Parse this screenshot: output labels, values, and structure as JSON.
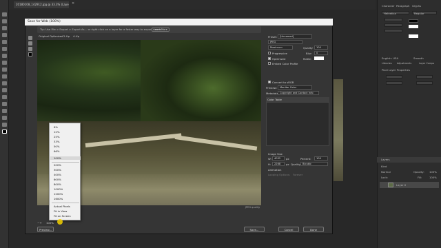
{
  "document_tab": {
    "title": "20180108_142912.jpg @ 33.3% (Layer 0, RGB/8)",
    "close": "×"
  },
  "dialog": {
    "title": "Save for Web (100%)",
    "info_bar": "Tip: Use File > Export > Export As... or right click on a layer for a faster way to export assets",
    "learn_more": "Learn More",
    "view_tabs": [
      "Original",
      "Optimized",
      "2-Up",
      "4-Up"
    ],
    "photo_caption": "JPEG quality",
    "zoom_value": "100%",
    "buttons": {
      "preview": "Preview...",
      "save": "Save...",
      "cancel": "Cancel",
      "done": "Done"
    }
  },
  "zoom_menu": {
    "items": [
      "6%",
      "12%",
      "25%",
      "33%",
      "50%",
      "66%",
      "100%",
      "200%",
      "300%",
      "400%",
      "600%",
      "800%",
      "1000%",
      "1200%",
      "1600%"
    ],
    "selected": "100%",
    "extra": [
      "Actual Pixels",
      "Fit in View",
      "Fit on Screen"
    ]
  },
  "settings": {
    "preset_label": "Preset:",
    "preset_value": "[Unnamed]",
    "format": "JPEG",
    "compression": "Maximum",
    "quality_label": "Quality:",
    "quality_value": "100",
    "progressive": "Progressive",
    "blur_label": "Blur:",
    "blur_value": "0",
    "optimized": "Optimized",
    "matte_label": "Matte:",
    "embed_profile": "Embed Color Profile",
    "convert_srgb": "Convert to sRGB",
    "preview_label": "Preview:",
    "preview_value": "Monitor Color",
    "metadata_label": "Metadata:",
    "metadata_value": "Copyright and Contact Info",
    "color_table": "Color Table",
    "image_size": "Image Size",
    "w_label": "W:",
    "w_value": "4032",
    "h_label": "H:",
    "h_value": "2268",
    "px": "px",
    "percent_label": "Percent:",
    "percent_value": "100",
    "quality2_label": "Quality:",
    "quality2_value": "Bicubic",
    "animation": "Animation",
    "looping_label": "Looping Options:",
    "looping_value": "Forever"
  },
  "right_panel": {
    "tabs": [
      "Character",
      "Paragraph",
      "Glyphs"
    ],
    "font": "Helvetica",
    "style": "Regular",
    "lang": "English: USA",
    "aa": "Smooth",
    "props_tabs": [
      "Libraries",
      "Adjustments",
      "Layer Comps"
    ],
    "props_title": "Pixel Layer Properties",
    "layers_title": "Layers",
    "blend": "Normal",
    "opacity_label": "Opacity:",
    "opacity_value": "100%",
    "lock_label": "Lock:",
    "fill_label": "Fill:",
    "fill_value": "100%",
    "kind_label": "Kind",
    "layer_name": "Layer 0"
  }
}
